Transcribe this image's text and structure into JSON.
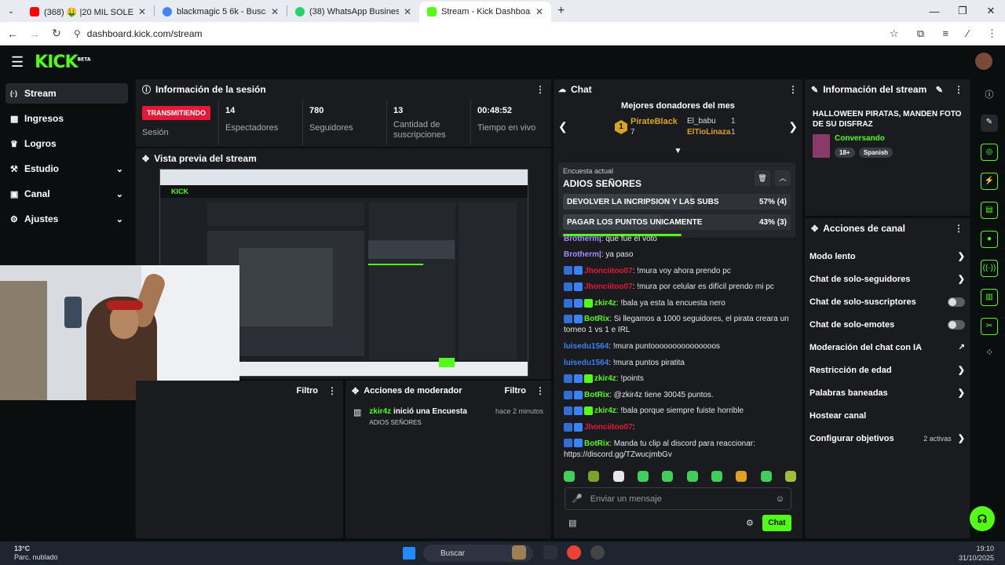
{
  "browser": {
    "tabs": [
      {
        "label": "(368) 🤑 |20 MIL SOLES x Conc",
        "color": "#ff0000"
      },
      {
        "label": "blackmagic 5 6k - Buscar con G",
        "color": "#4285f4"
      },
      {
        "label": "(38) WhatsApp Business",
        "color": "#25d366"
      },
      {
        "label": "Stream - Kick Dashboard",
        "color": "#53fc18"
      }
    ],
    "url": "dashboard.kick.com/stream"
  },
  "sidebar": {
    "items": [
      {
        "label": "Stream",
        "icon": "stream-icon",
        "glyph": "(·)"
      },
      {
        "label": "Ingresos",
        "icon": "revenue-icon",
        "glyph": "▦"
      },
      {
        "label": "Logros",
        "icon": "trophy-icon",
        "glyph": "♛"
      },
      {
        "label": "Estudio",
        "icon": "studio-icon",
        "glyph": "⚒"
      },
      {
        "label": "Canal",
        "icon": "channel-icon",
        "glyph": "▣"
      },
      {
        "label": "Ajustes",
        "icon": "settings-icon",
        "glyph": "⚙"
      }
    ]
  },
  "session": {
    "title": "Información de la sesión",
    "live_badge": "TRANSMITIENDO",
    "session_label": "Sesión",
    "stats": [
      {
        "value": "14",
        "label": "Espectadores"
      },
      {
        "value": "780",
        "label": "Seguidores"
      },
      {
        "value": "13",
        "label": "Cantidad de suscripciones"
      },
      {
        "value": "00:48:52",
        "label": "Tiempo en vivo"
      }
    ]
  },
  "preview": {
    "title": "Vista previa del stream",
    "logo": "KICK"
  },
  "filters": {
    "left_filter": "Filtro",
    "mod_title": "Acciones de moderador",
    "mod_filter": "Filtro"
  },
  "mod_action": {
    "user": "zkir4z",
    "action": "inició una Encuesta",
    "time": "hace 2 minutos",
    "detail": "ADIOS SEÑORES"
  },
  "chat": {
    "title": "Chat",
    "donors_title": "Mejores donadores del mes",
    "donors": [
      {
        "rank": "1",
        "name": "PirateBlack",
        "amount": "7"
      },
      {
        "name": "El_babu",
        "amount": "1"
      },
      {
        "name": "ElTioLinaza",
        "amount": "1"
      }
    ],
    "poll": {
      "caption": "Encuesta actual",
      "question": "ADIOS SEÑORES",
      "options": [
        {
          "label": "DEVOLVER LA INCRIPSION Y LAS SUBS",
          "result": "57% (4)",
          "share": 0.57
        },
        {
          "label": "PAGAR LOS PUNTOS UNICAMENTE",
          "result": "43% (3)",
          "share": 0.43
        }
      ],
      "time_remaining": 0.55
    },
    "messages": [
      {
        "user": "Brotherm|",
        "text": ": que fue el voto",
        "color": "#a58bff"
      },
      {
        "user": "Brotherm|",
        "text": ": ya paso",
        "color": "#a58bff"
      },
      {
        "user": "Jhonciitoo07",
        "text": ": !mura voy ahora prendo pc",
        "color": "#e5183a",
        "badges": 2
      },
      {
        "user": "Jhonciitoo07",
        "text": ": !mura por celular es difícil prendo mi pc",
        "color": "#e5183a",
        "badges": 2
      },
      {
        "user": "zkir4z",
        "text": ": !bala ya esta la encuesta nero",
        "color": "#53fc18",
        "badges": 3
      },
      {
        "user": "BotRix",
        "text": ": Si llegamos a 1000 seguidores, el pirata creara un torneo 1 vs 1 e IRL",
        "color": "#53fc18",
        "badges": 2
      },
      {
        "user": "luisedu1564",
        "text": ": !mura puntooooooooooooooos",
        "color": "#3b82f6"
      },
      {
        "user": "luisedu1564",
        "text": ": !mura puntos piratita",
        "color": "#3b82f6"
      },
      {
        "user": "zkir4z",
        "text": ": !points",
        "color": "#53fc18",
        "badges": 3
      },
      {
        "user": "BotRix",
        "text": ": @zkir4z tiene 30045 puntos.",
        "color": "#53fc18",
        "badges": 2
      },
      {
        "user": "zkir4z",
        "text": ": !bala porque siempre fuiste horrible",
        "color": "#53fc18",
        "badges": 3
      },
      {
        "user": "Jhonciitoo07",
        "text": ":",
        "color": "#e5183a",
        "badges": 2
      },
      {
        "user": "BotRix",
        "text": ": Manda tu clip al discord para reaccionar: https://discord.gg/TZwucjmbGv",
        "color": "#53fc18",
        "badges": 2
      }
    ],
    "input_placeholder": "Enviar un mensaje",
    "send_label": "Chat"
  },
  "stream_info": {
    "title": "Información del stream",
    "stream_title": "HALLOWEEN PIRATAS, MANDEN FOTO DE SU DISFRAZ",
    "category": "Conversando",
    "tags": [
      "18+",
      "Spanish"
    ]
  },
  "channel_actions": {
    "title": "Acciones de canal",
    "items": [
      {
        "label": "Modo lento",
        "control": "chevron"
      },
      {
        "label": "Chat de solo-seguidores",
        "control": "chevron"
      },
      {
        "label": "Chat de solo-suscriptores",
        "control": "toggle"
      },
      {
        "label": "Chat de solo-emotes",
        "control": "toggle"
      },
      {
        "label": "Moderación del chat con IA",
        "control": "external"
      },
      {
        "label": "Restricción de edad",
        "control": "chevron"
      },
      {
        "label": "Palabras baneadas",
        "control": "chevron"
      },
      {
        "label": "Hostear canal",
        "control": "none"
      },
      {
        "label": "Configurar objetivos",
        "control": "chevron",
        "extra": "2 activas"
      }
    ]
  },
  "taskbar": {
    "temp": "13°C",
    "weather": "Parc. nublado",
    "search": "Buscar",
    "time": "19:10",
    "date": "31/10/2025"
  },
  "colors": {
    "accent": "#53fc18",
    "live": "#e5183a",
    "panel": "#191b1f",
    "bg": "#0b0e0f"
  }
}
